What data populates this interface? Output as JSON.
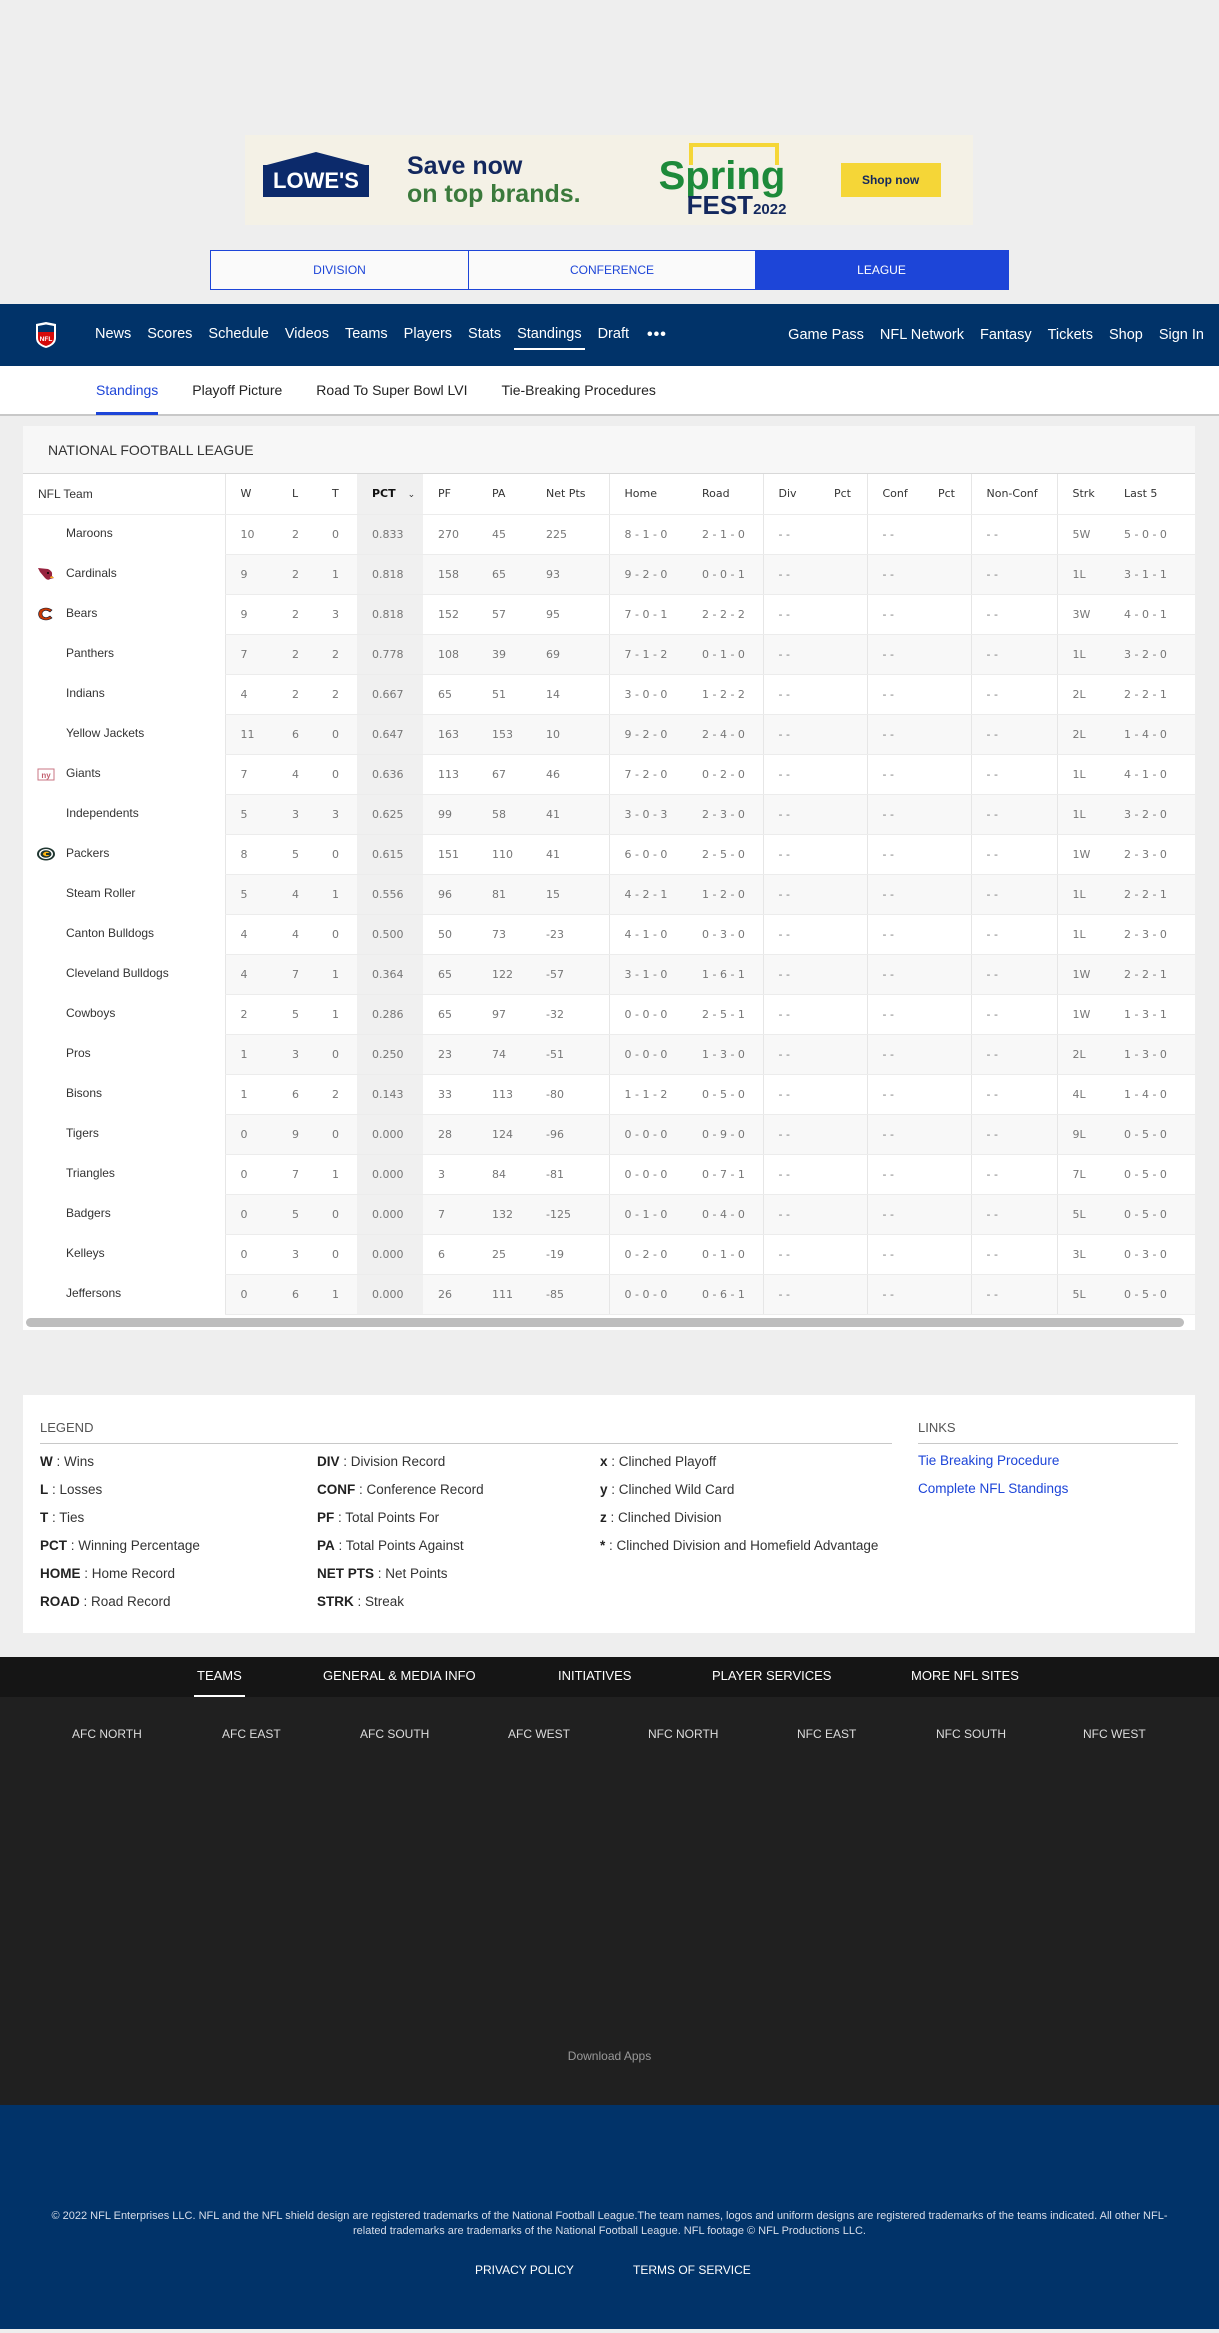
{
  "ad": {
    "brand": "LOWE'S",
    "headline_line1": "Save now",
    "headline_line2": "on top brands.",
    "promo_word1": "Spring",
    "promo_word2": "FEST",
    "promo_year": "2022",
    "cta": "Shop now"
  },
  "segment": {
    "options": [
      "DIVISION",
      "CONFERENCE",
      "LEAGUE"
    ],
    "selected": "LEAGUE"
  },
  "topnav": {
    "logo": "NFL",
    "left": [
      "News",
      "Scores",
      "Schedule",
      "Videos",
      "Teams",
      "Players",
      "Stats",
      "Standings",
      "Draft"
    ],
    "active": "Standings",
    "more": "•••",
    "right": [
      "Game Pass",
      "NFL Network",
      "Fantasy",
      "Tickets",
      "Shop",
      "Sign In"
    ]
  },
  "subnav": {
    "items": [
      "Standings",
      "Playoff Picture",
      "Road To Super Bowl LVI",
      "Tie-Breaking Procedures"
    ],
    "active": "Standings"
  },
  "standings": {
    "title": "NATIONAL FOOTBALL LEAGUE",
    "sort_column": "PCT",
    "columns": [
      "NFL Team",
      "W",
      "L",
      "T",
      "PCT",
      "PF",
      "PA",
      "Net Pts",
      "Home",
      "Road",
      "Div",
      "Pct",
      "Conf",
      "Pct",
      "Non-Conf",
      "Strk",
      "Last 5"
    ],
    "rows": [
      {
        "team": "Maroons",
        "logo": "",
        "w": "10",
        "l": "2",
        "t": "0",
        "pct": "0.833",
        "pf": "270",
        "pa": "45",
        "net": "225",
        "home": "8 - 1 - 0",
        "road": "2 - 1 - 0",
        "div": "- -",
        "divpct": "",
        "conf": "- -",
        "confpct": "",
        "nonconf": "- -",
        "strk": "5W",
        "last5": "5 - 0 - 0"
      },
      {
        "team": "Cardinals",
        "logo": "cardinals-logo",
        "w": "9",
        "l": "2",
        "t": "1",
        "pct": "0.818",
        "pf": "158",
        "pa": "65",
        "net": "93",
        "home": "9 - 2 - 0",
        "road": "0 - 0 - 1",
        "div": "- -",
        "divpct": "",
        "conf": "- -",
        "confpct": "",
        "nonconf": "- -",
        "strk": "1L",
        "last5": "3 - 1 - 1"
      },
      {
        "team": "Bears",
        "logo": "bears-logo",
        "w": "9",
        "l": "2",
        "t": "3",
        "pct": "0.818",
        "pf": "152",
        "pa": "57",
        "net": "95",
        "home": "7 - 0 - 1",
        "road": "2 - 2 - 2",
        "div": "- -",
        "divpct": "",
        "conf": "- -",
        "confpct": "",
        "nonconf": "- -",
        "strk": "3W",
        "last5": "4 - 0 - 1"
      },
      {
        "team": "Panthers",
        "logo": "",
        "w": "7",
        "l": "2",
        "t": "2",
        "pct": "0.778",
        "pf": "108",
        "pa": "39",
        "net": "69",
        "home": "7 - 1 - 2",
        "road": "0 - 1 - 0",
        "div": "- -",
        "divpct": "",
        "conf": "- -",
        "confpct": "",
        "nonconf": "- -",
        "strk": "1L",
        "last5": "3 - 2 - 0"
      },
      {
        "team": "Indians",
        "logo": "",
        "w": "4",
        "l": "2",
        "t": "2",
        "pct": "0.667",
        "pf": "65",
        "pa": "51",
        "net": "14",
        "home": "3 - 0 - 0",
        "road": "1 - 2 - 2",
        "div": "- -",
        "divpct": "",
        "conf": "- -",
        "confpct": "",
        "nonconf": "- -",
        "strk": "2L",
        "last5": "2 - 2 - 1"
      },
      {
        "team": "Yellow Jackets",
        "logo": "",
        "w": "11",
        "l": "6",
        "t": "0",
        "pct": "0.647",
        "pf": "163",
        "pa": "153",
        "net": "10",
        "home": "9 - 2 - 0",
        "road": "2 - 4 - 0",
        "div": "- -",
        "divpct": "",
        "conf": "- -",
        "confpct": "",
        "nonconf": "- -",
        "strk": "2L",
        "last5": "1 - 4 - 0"
      },
      {
        "team": "Giants",
        "logo": "giants-logo",
        "w": "7",
        "l": "4",
        "t": "0",
        "pct": "0.636",
        "pf": "113",
        "pa": "67",
        "net": "46",
        "home": "7 - 2 - 0",
        "road": "0 - 2 - 0",
        "div": "- -",
        "divpct": "",
        "conf": "- -",
        "confpct": "",
        "nonconf": "- -",
        "strk": "1L",
        "last5": "4 - 1 - 0"
      },
      {
        "team": "Independents",
        "logo": "",
        "w": "5",
        "l": "3",
        "t": "3",
        "pct": "0.625",
        "pf": "99",
        "pa": "58",
        "net": "41",
        "home": "3 - 0 - 3",
        "road": "2 - 3 - 0",
        "div": "- -",
        "divpct": "",
        "conf": "- -",
        "confpct": "",
        "nonconf": "- -",
        "strk": "1L",
        "last5": "3 - 2 - 0"
      },
      {
        "team": "Packers",
        "logo": "packers-logo",
        "w": "8",
        "l": "5",
        "t": "0",
        "pct": "0.615",
        "pf": "151",
        "pa": "110",
        "net": "41",
        "home": "6 - 0 - 0",
        "road": "2 - 5 - 0",
        "div": "- -",
        "divpct": "",
        "conf": "- -",
        "confpct": "",
        "nonconf": "- -",
        "strk": "1W",
        "last5": "2 - 3 - 0"
      },
      {
        "team": "Steam Roller",
        "logo": "",
        "w": "5",
        "l": "4",
        "t": "1",
        "pct": "0.556",
        "pf": "96",
        "pa": "81",
        "net": "15",
        "home": "4 - 2 - 1",
        "road": "1 - 2 - 0",
        "div": "- -",
        "divpct": "",
        "conf": "- -",
        "confpct": "",
        "nonconf": "- -",
        "strk": "1L",
        "last5": "2 - 2 - 1"
      },
      {
        "team": "Canton Bulldogs",
        "logo": "",
        "w": "4",
        "l": "4",
        "t": "0",
        "pct": "0.500",
        "pf": "50",
        "pa": "73",
        "net": "-23",
        "home": "4 - 1 - 0",
        "road": "0 - 3 - 0",
        "div": "- -",
        "divpct": "",
        "conf": "- -",
        "confpct": "",
        "nonconf": "- -",
        "strk": "1L",
        "last5": "2 - 3 - 0"
      },
      {
        "team": "Cleveland Bulldogs",
        "logo": "",
        "w": "4",
        "l": "7",
        "t": "1",
        "pct": "0.364",
        "pf": "65",
        "pa": "122",
        "net": "-57",
        "home": "3 - 1 - 0",
        "road": "1 - 6 - 1",
        "div": "- -",
        "divpct": "",
        "conf": "- -",
        "confpct": "",
        "nonconf": "- -",
        "strk": "1W",
        "last5": "2 - 2 - 1"
      },
      {
        "team": "Cowboys",
        "logo": "",
        "w": "2",
        "l": "5",
        "t": "1",
        "pct": "0.286",
        "pf": "65",
        "pa": "97",
        "net": "-32",
        "home": "0 - 0 - 0",
        "road": "2 - 5 - 1",
        "div": "- -",
        "divpct": "",
        "conf": "- -",
        "confpct": "",
        "nonconf": "- -",
        "strk": "1W",
        "last5": "1 - 3 - 1"
      },
      {
        "team": "Pros",
        "logo": "",
        "w": "1",
        "l": "3",
        "t": "0",
        "pct": "0.250",
        "pf": "23",
        "pa": "74",
        "net": "-51",
        "home": "0 - 0 - 0",
        "road": "1 - 3 - 0",
        "div": "- -",
        "divpct": "",
        "conf": "- -",
        "confpct": "",
        "nonconf": "- -",
        "strk": "2L",
        "last5": "1 - 3 - 0"
      },
      {
        "team": "Bisons",
        "logo": "",
        "w": "1",
        "l": "6",
        "t": "2",
        "pct": "0.143",
        "pf": "33",
        "pa": "113",
        "net": "-80",
        "home": "1 - 1 - 2",
        "road": "0 - 5 - 0",
        "div": "- -",
        "divpct": "",
        "conf": "- -",
        "confpct": "",
        "nonconf": "- -",
        "strk": "4L",
        "last5": "1 - 4 - 0"
      },
      {
        "team": "Tigers",
        "logo": "",
        "w": "0",
        "l": "9",
        "t": "0",
        "pct": "0.000",
        "pf": "28",
        "pa": "124",
        "net": "-96",
        "home": "0 - 0 - 0",
        "road": "0 - 9 - 0",
        "div": "- -",
        "divpct": "",
        "conf": "- -",
        "confpct": "",
        "nonconf": "- -",
        "strk": "9L",
        "last5": "0 - 5 - 0"
      },
      {
        "team": "Triangles",
        "logo": "",
        "w": "0",
        "l": "7",
        "t": "1",
        "pct": "0.000",
        "pf": "3",
        "pa": "84",
        "net": "-81",
        "home": "0 - 0 - 0",
        "road": "0 - 7 - 1",
        "div": "- -",
        "divpct": "",
        "conf": "- -",
        "confpct": "",
        "nonconf": "- -",
        "strk": "7L",
        "last5": "0 - 5 - 0"
      },
      {
        "team": "Badgers",
        "logo": "",
        "w": "0",
        "l": "5",
        "t": "0",
        "pct": "0.000",
        "pf": "7",
        "pa": "132",
        "net": "-125",
        "home": "0 - 1 - 0",
        "road": "0 - 4 - 0",
        "div": "- -",
        "divpct": "",
        "conf": "- -",
        "confpct": "",
        "nonconf": "- -",
        "strk": "5L",
        "last5": "0 - 5 - 0"
      },
      {
        "team": "Kelleys",
        "logo": "",
        "w": "0",
        "l": "3",
        "t": "0",
        "pct": "0.000",
        "pf": "6",
        "pa": "25",
        "net": "-19",
        "home": "0 - 2 - 0",
        "road": "0 - 1 - 0",
        "div": "- -",
        "divpct": "",
        "conf": "- -",
        "confpct": "",
        "nonconf": "- -",
        "strk": "3L",
        "last5": "0 - 3 - 0"
      },
      {
        "team": "Jeffersons",
        "logo": "",
        "w": "0",
        "l": "6",
        "t": "1",
        "pct": "0.000",
        "pf": "26",
        "pa": "111",
        "net": "-85",
        "home": "0 - 0 - 0",
        "road": "0 - 6 - 1",
        "div": "- -",
        "divpct": "",
        "conf": "- -",
        "confpct": "",
        "nonconf": "- -",
        "strk": "5L",
        "last5": "0 - 5 - 0"
      }
    ]
  },
  "legend": {
    "title": "LEGEND",
    "columns": [
      [
        {
          "k": "W",
          "v": "Wins"
        },
        {
          "k": "L",
          "v": "Losses"
        },
        {
          "k": "T",
          "v": "Ties"
        },
        {
          "k": "PCT",
          "v": "Winning Percentage"
        },
        {
          "k": "HOME",
          "v": "Home Record"
        },
        {
          "k": "ROAD",
          "v": "Road Record"
        }
      ],
      [
        {
          "k": "DIV",
          "v": "Division Record"
        },
        {
          "k": "CONF",
          "v": "Conference Record"
        },
        {
          "k": "PF",
          "v": "Total Points For"
        },
        {
          "k": "PA",
          "v": "Total Points Against"
        },
        {
          "k": "NET PTS",
          "v": "Net Points"
        },
        {
          "k": "STRK",
          "v": "Streak"
        }
      ],
      [
        {
          "k": "x",
          "v": "Clinched Playoff"
        },
        {
          "k": "y",
          "v": "Clinched Wild Card"
        },
        {
          "k": "z",
          "v": "Clinched Division"
        },
        {
          "k": "*",
          "v": "Clinched Division and Homefield Advantage"
        }
      ]
    ]
  },
  "links": {
    "title": "LINKS",
    "items": [
      "Tie Breaking Procedure",
      "Complete NFL Standings"
    ]
  },
  "footer": {
    "tabs": [
      "TEAMS",
      "GENERAL & MEDIA INFO",
      "INITIATIVES",
      "PLAYER SERVICES",
      "MORE NFL SITES"
    ],
    "active_tab": "TEAMS",
    "divisions": [
      "AFC NORTH",
      "AFC EAST",
      "AFC SOUTH",
      "AFC WEST",
      "NFC NORTH",
      "NFC EAST",
      "NFC SOUTH",
      "NFC WEST"
    ],
    "download_apps": "Download Apps",
    "copyright": "© 2022 NFL Enterprises LLC. NFL and the NFL shield design are registered trademarks of the National Football League.The team names, logos and uniform designs are registered trademarks of the teams indicated. All other NFL-related trademarks are trademarks of the National Football League. NFL footage © NFL Productions LLC.",
    "legal": [
      "PRIVACY POLICY",
      "TERMS OF SERVICE"
    ]
  },
  "colors": {
    "nfl_navy": "#013369",
    "accent_blue": "#1d45d8",
    "footer_dark": "#202020"
  }
}
